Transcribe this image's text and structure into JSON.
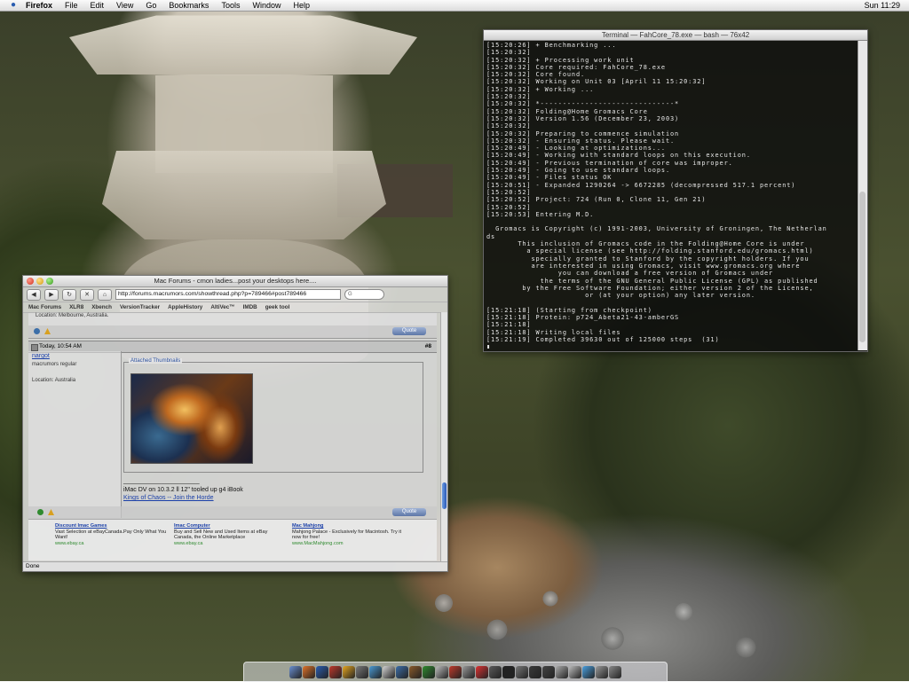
{
  "menubar": {
    "app": "Firefox",
    "items": [
      "File",
      "Edit",
      "View",
      "Go",
      "Bookmarks",
      "Tools",
      "Window",
      "Help"
    ],
    "clock": "Sun 11:29"
  },
  "terminal": {
    "title": "Terminal — FahCore_78.exe — bash — 76x42",
    "lines": [
      "[15:20:26] + Benchmarking ...",
      "[15:20:32]",
      "[15:20:32] + Processing work unit",
      "[15:20:32] Core required: FahCore_78.exe",
      "[15:20:32] Core found.",
      "[15:20:32] Working on Unit 03 [April 11 15:20:32]",
      "[15:20:32] + Working ...",
      "[15:20:32]",
      "[15:20:32] *------------------------------*",
      "[15:20:32] Folding@Home Gromacs Core",
      "[15:20:32] Version 1.56 (December 23, 2003)",
      "[15:20:32]",
      "[15:20:32] Preparing to commence simulation",
      "[15:20:32] - Ensuring status. Please wait.",
      "[15:20:49] - Looking at optimizations...",
      "[15:20:49] - Working with standard loops on this execution.",
      "[15:20:49] - Previous termination of core was improper.",
      "[15:20:49] - Going to use standard loops.",
      "[15:20:49] - Files status OK",
      "[15:20:51] - Expanded 1290264 -> 6672285 (decompressed 517.1 percent)",
      "[15:20:52]",
      "[15:20:52] Project: 724 (Run 0, Clone 11, Gen 21)",
      "[15:20:52]",
      "[15:20:53] Entering M.D.",
      "",
      "  Gromacs is Copyright (c) 1991-2003, University of Groningen, The Netherlan",
      "ds",
      "       This inclusion of Gromacs code in the Folding@Home Core is under",
      "         a special license (see http://folding.stanford.edu/gromacs.html)",
      "          specially granted to Stanford by the copyright holders. If you",
      "          are interested in using Gromacs, visit www.gromacs.org where",
      "                you can download a free version of Gromacs under",
      "            the terms of the GNU General Public License (GPL) as published",
      "        by the Free Software Foundation; either version 2 of the License,",
      "                      or (at your option) any later version.",
      "",
      "[15:21:18] (Starting from checkpoint)",
      "[15:21:18] Protein: p724_Abeta21-43-amberGS",
      "[15:21:18]",
      "[15:21:18] Writing local files",
      "[15:21:19] Completed 39630 out of 125000 steps  (31)",
      "▮"
    ]
  },
  "browser": {
    "title": "Mac Forums - cmon ladies...post your desktops here....",
    "url": "http://forums.macrumors.com/showthread.php?p=789466#post789466",
    "search_placeholder": "G",
    "bookmarks": [
      "Mac Forums",
      "XLR8",
      "Xbench",
      "VersionTracker",
      "AppleHistory",
      "AltiVec™",
      "IMDB",
      "geek tool"
    ],
    "prev_location": "Location: Melbourne, Australia.",
    "quote_label": "Quote",
    "post": {
      "date": "Today, 10:54 AM",
      "number": "#8",
      "username": "nargot",
      "user_title": "macrumors regular",
      "location": "Location: Australia",
      "attached_label": "Attached Thumbnails",
      "sig_rule": "______________________",
      "sig_line": "iMac DV on 10.3.2 ll 12\" tooled up g4 iBook",
      "sig_link": "Kings of Chaos -- Join the Horde"
    },
    "ads": [
      {
        "title": "Discount Imac Games",
        "desc": "Vast Selection at eBayCanada.Pay Only What You Want!",
        "url": "www.ebay.ca"
      },
      {
        "title": "Imac Computer",
        "desc": "Buy and Sell New and Used Items at eBay Canada, the Online Marketplace",
        "url": "www.ebay.ca"
      },
      {
        "title": "Mac Mahjong",
        "desc": "Mahjong Palace - Exclusively for Macintosh. Try it now for free!",
        "url": "www.MacMahjong.com"
      }
    ],
    "status": "Done"
  },
  "dock": {
    "icon_colors": [
      "#6a8fd0",
      "#e0732a",
      "#2a5db0",
      "#c0392b",
      "#e6a620",
      "#7a7a7a",
      "#4a9ad4",
      "#d4d4d4",
      "#3c6ea8",
      "#8a5a2a",
      "#2f8a2f",
      "#bbbbbb",
      "#c03a2b",
      "#999999",
      "#dd3333",
      "#5a5a5a",
      "#222222",
      "#777777",
      "#3a3a3a",
      "#444444",
      "#aaaaaa",
      "#bbbbbb",
      "#4aa0e0",
      "#999999",
      "#888888"
    ]
  }
}
